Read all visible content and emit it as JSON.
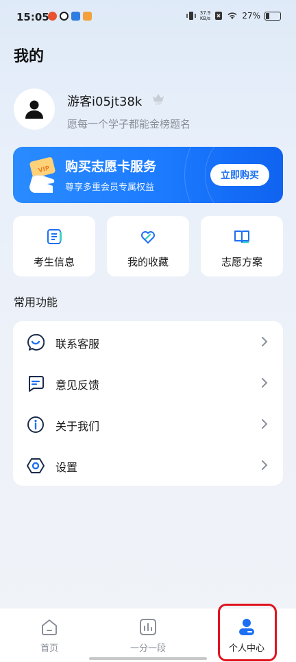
{
  "status_bar": {
    "time": "15:05",
    "network_speed_value": "37.9",
    "network_speed_unit": "KB/s",
    "battery_percent": "27%",
    "battery_level": 0.27
  },
  "page": {
    "title": "我的"
  },
  "profile": {
    "username": "游客i05jt38k",
    "slogan": "愿每一个学子都能金榜题名"
  },
  "banner": {
    "title": "购买志愿卡服务",
    "subtitle": "尊享多重会员专属权益",
    "button_label": "立即购买"
  },
  "quick_actions": [
    {
      "label": "考生信息",
      "icon": "list-icon"
    },
    {
      "label": "我的收藏",
      "icon": "heart-icon"
    },
    {
      "label": "志愿方案",
      "icon": "book-icon"
    }
  ],
  "common_section": {
    "title": "常用功能",
    "items": [
      {
        "label": "联系客服",
        "icon": "customer-service-icon"
      },
      {
        "label": "意见反馈",
        "icon": "feedback-icon"
      },
      {
        "label": "关于我们",
        "icon": "info-icon"
      },
      {
        "label": "设置",
        "icon": "settings-icon"
      }
    ]
  },
  "tab_bar": {
    "tabs": [
      {
        "label": "首页",
        "icon": "home-icon"
      },
      {
        "label": "一分一段",
        "icon": "bar-chart-icon"
      },
      {
        "label": "个人中心",
        "icon": "profile-icon"
      }
    ],
    "active_index": 2
  },
  "colors": {
    "accent": "#1c6ff2",
    "banner_start": "#2a8bff",
    "banner_end": "#0f63f0",
    "highlight_outline": "#e0141e"
  }
}
